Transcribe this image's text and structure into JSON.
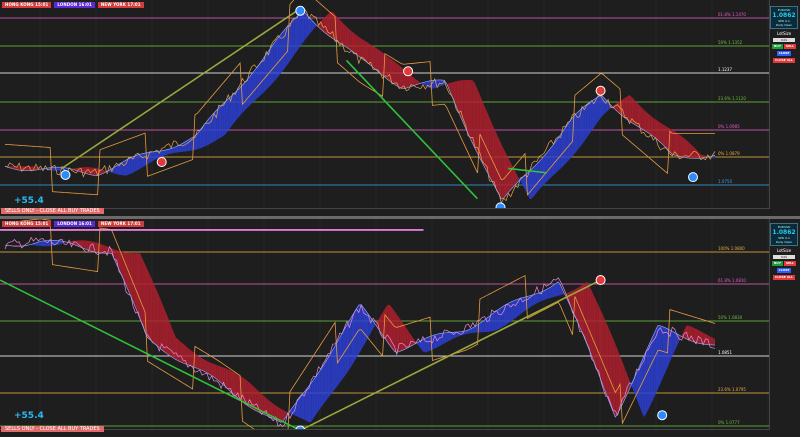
{
  "sessions": [
    {
      "label": "HONG KONG 15:01",
      "color": "#d23c3c"
    },
    {
      "label": "LONDON 16:01",
      "color": "#5a2ad8"
    },
    {
      "label": "NEW YORK 17:01",
      "color": "#d23c3c"
    }
  ],
  "top": {
    "profit": "+55.4",
    "warning": "SELLS ONLY - CLOSE ALL BUY TRADES",
    "levels": [
      {
        "label": "61.8% 1.1470",
        "color": "#e060c0",
        "f": 0.085
      },
      {
        "label": "50% 1.1352",
        "color": "#6fbf3c",
        "f": 0.215
      },
      {
        "label": "1.1237",
        "color": "#ffffff",
        "f": 0.34
      },
      {
        "label": "23.6% 1.1120",
        "color": "#6fbf3c",
        "f": 0.47
      },
      {
        "label": "0% 1.0985",
        "color": "#e060c0",
        "f": 0.6
      },
      {
        "label": "0% 1.0879",
        "color": "#e6b040",
        "f": 0.725
      },
      {
        "label": "1.0750",
        "color": "#3aa0e0",
        "f": 0.855
      }
    ]
  },
  "bottom": {
    "profit": "+55.4",
    "warning": "SELLS ONLY - CLOSE ALL BUY TRADES",
    "levels": [
      {
        "label": "100% 1.0800",
        "color": "#e6b040",
        "f": 0.15
      },
      {
        "label": "61.8% 1.0810",
        "color": "#e060c0",
        "f": 0.3
      },
      {
        "label": "50% 1.0830",
        "color": "#6fbf3c",
        "f": 0.47
      },
      {
        "label": "1.0851",
        "color": "#ffffff",
        "f": 0.63
      },
      {
        "label": "23.6% 1.0795",
        "color": "#e6b040",
        "f": 0.8
      },
      {
        "label": "0% 1.0777",
        "color": "#6fbf3c",
        "f": 0.95
      }
    ]
  },
  "panels": [
    {
      "symbol": "EURUSD",
      "price": "1.0862",
      "spread": "SPD 0.1",
      "detail": "Daily Open",
      "lots_label": "LotSize",
      "lot_value": "0.01",
      "sell": "SELL",
      "buy": "BUY",
      "close": "CLOSE",
      "close_all": "CLOSE ALL"
    },
    {
      "symbol": "EURUSD",
      "price": "1.0862",
      "spread": "SPD 0.1",
      "detail": "Daily Open",
      "lots_label": "LotSize",
      "lot_value": "0.01",
      "sell": "SELL",
      "buy": "BUY",
      "close": "CLOSE",
      "close_all": "CLOSE ALL"
    }
  ]
}
